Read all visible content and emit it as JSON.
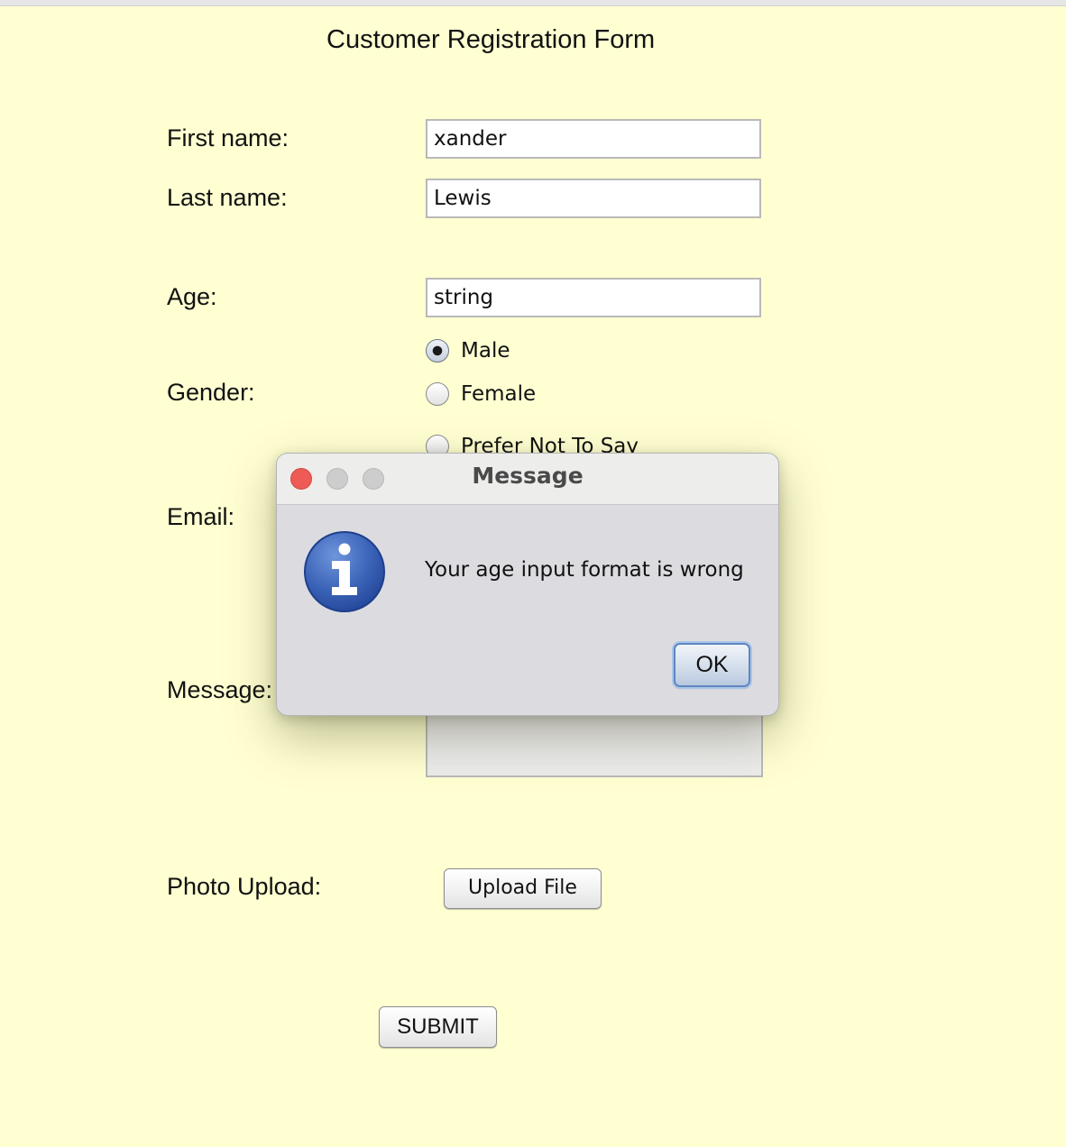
{
  "form": {
    "title": "Customer Registration Form",
    "labels": {
      "first_name": "First name:",
      "last_name": "Last name:",
      "age": "Age:",
      "gender": "Gender:",
      "email": "Email:",
      "message": "Message:",
      "photo_upload": "Photo Upload:"
    },
    "values": {
      "first_name": "xander",
      "last_name": "Lewis",
      "age": "string"
    },
    "gender_options": [
      {
        "label": "Male",
        "selected": true
      },
      {
        "label": "Female",
        "selected": false
      },
      {
        "label": "Prefer Not To Say",
        "selected": false
      }
    ],
    "upload_button": "Upload File",
    "submit_button": "SUBMIT"
  },
  "dialog": {
    "title": "Message",
    "message": "Your age input format is wrong",
    "ok_button": "OK",
    "icon": "info-icon",
    "colors": {
      "icon_blue": "#2f56a8",
      "close_red": "#ee5b56"
    }
  }
}
